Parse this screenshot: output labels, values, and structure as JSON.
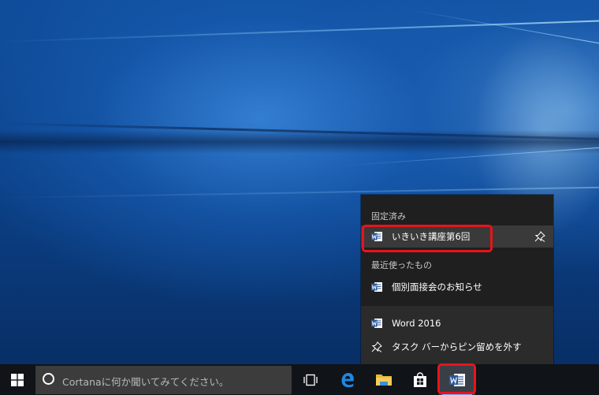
{
  "desktop": {
    "wallpaper": "Windows 10 hero"
  },
  "jumplist": {
    "pinned_header": "固定済み",
    "pinned_items": [
      {
        "label": "いきいき講座第6回",
        "icon": "word-document-icon"
      }
    ],
    "recent_header": "最近使ったもの",
    "recent_items": [
      {
        "label": "個別面接会のお知らせ",
        "icon": "word-document-icon"
      }
    ],
    "app_label": "Word 2016",
    "unpin_label": "タスク バーからピン留めを外す"
  },
  "taskbar": {
    "search_placeholder": "Cortanaに何か聞いてみてください。",
    "icons": [
      "windows-start-icon",
      "cortana-icon",
      "task-view-icon",
      "edge-icon",
      "file-explorer-icon",
      "store-icon",
      "word-icon"
    ]
  },
  "colors": {
    "highlight": "#e8141c",
    "word_blue": "#2b579a",
    "taskbar": "#101318",
    "jumplist_bg": "#2b2b2b"
  }
}
